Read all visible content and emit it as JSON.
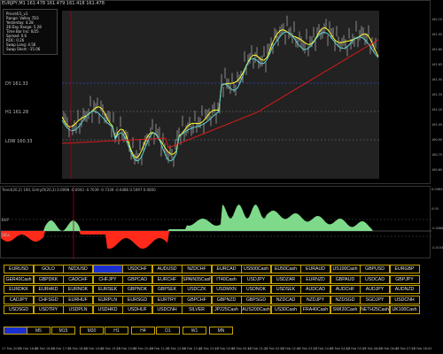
{
  "chart_title": "EURJPY,M1  161.478 161.479 161.418 161.478",
  "info_panel": [
    "Price/4/1_v1",
    "Range: Valley    7D3",
    "Yesterday:    4.28",
    "28 Day Range:  5.28",
    "Time Bar Inc:   0/25",
    "Spread:    0.6",
    "ROC:    0.26",
    "Swap Long:   4.56",
    "Swap Short:  -15.06"
  ],
  "levels": {
    "d1": "DY  161.33",
    "h1": "H1  161.28",
    "low": "LOW  160.33"
  },
  "price_axis": [
    "162.10",
    "161.95",
    "161.80",
    "161.65",
    "161.50",
    "161.35",
    "161.20",
    "161.05",
    "160.90",
    "160.75",
    "160.60"
  ],
  "oscillator_title": "Trend(20,2) 100, Entry/0(20,3)  0.0098  -0.0043 -0.7039 -0.7339 -0.0486 0.5097 0.0000",
  "osc_levels": {
    "upper": "BUY",
    "lower": "SELL"
  },
  "osc_axis": [
    "0.00847",
    "0.00",
    "-0.0088",
    "-0.01347"
  ],
  "symbols": [
    "EURUSD",
    "GOLD",
    "NZDUSD",
    "USDJPY",
    "USDCHF",
    "AUDUSD",
    "NZDCHF",
    "EURCAD",
    "US500Cash",
    "EU50Cash",
    "EURAUD",
    "US100Cash",
    "GBPUSD",
    "EURGBP",
    "GER40Cash",
    "GBPDKK",
    "CADCHF",
    "CHFJPY",
    "GBPCAD",
    "EURCHF",
    "SPAIN35Cash",
    "IT40Cash",
    "USDJPY",
    "USDZAR",
    "EURNZD",
    "GBPAUD",
    "USDCAD",
    "GBPJPY",
    "EURDKK",
    "EURHKD",
    "EURNOK",
    "EURSEK",
    "GBPNOK",
    "GBPSEK",
    "USDCZK",
    "USDMXN",
    "USDNOK",
    "USDSEK",
    "AUDCAD",
    "AUDCHF",
    "AUDJPY",
    "AUDNZD",
    "CADJPY",
    "CHFSGD",
    "EURHUF",
    "EURPLN",
    "EURSGD",
    "EURTRY",
    "GBPCHF",
    "GBPNZD",
    "GBPSGD",
    "NZDCAD",
    "NZDJPY",
    "NZDSGD",
    "SGDJPY",
    "USDCNH",
    "USDSGD",
    "USDTRY",
    "USDPLN",
    "USDHKD",
    "USDHUF",
    "USDCNH",
    "SILVER",
    "JP225Cash",
    "AUS200Cash",
    "US30Cash",
    "FRA40Cash",
    "SWI20Cash",
    "NETH25Cash",
    "UK100Cash"
  ],
  "active_symbol_index": 3,
  "timeframes": [
    "M1",
    "M5",
    "M15",
    "M30",
    "H1",
    "H4",
    "D1",
    "W1",
    "MN"
  ],
  "active_timeframe_index": 0,
  "time_axis": [
    "17 Feb 2019",
    "15 Feb 16:00",
    "15 Feb 16:40",
    "15 Feb 17:20",
    "15 Feb 18:00",
    "15 Feb 18:40",
    "15 Feb 19:20",
    "15 Feb 20:00",
    "15 Feb 20:40",
    "15 Feb 21:20",
    "15 Feb 22:00",
    "15 Feb 22:40",
    "15 Feb 23:20",
    "17 Feb 00:00",
    "17 Feb 00:40",
    "17 Feb 01:20",
    "17 Feb 02:00",
    "17 Feb 02:40",
    "17 Feb 03:20",
    "17 Feb 04:00",
    "17 Feb 04:40",
    "17 Feb 05:20",
    "17 Feb 06:00",
    "17 Feb 06:40",
    "17 Feb 07:20",
    "17 Feb 08:00"
  ],
  "colors": {
    "buy_fill": "#7fd98a",
    "sell_fill": "#ff2a1a",
    "ma_fast": "#ffff33",
    "ma_slow": "#d81b1b",
    "ma_mid": "#5ed0d0",
    "active": "#1a2fd0",
    "border": "#c8a400"
  }
}
